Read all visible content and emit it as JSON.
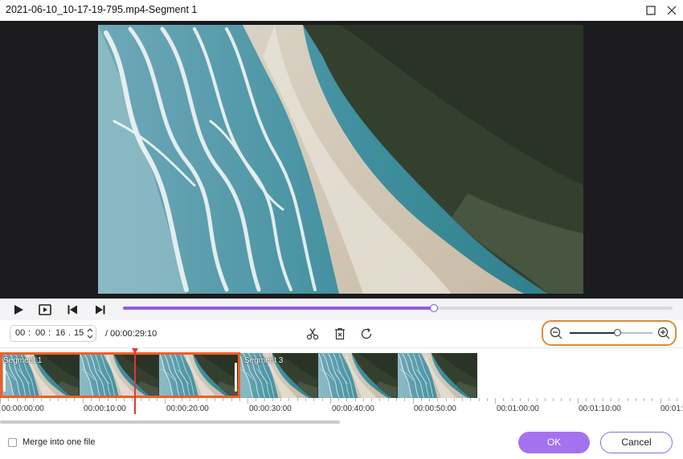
{
  "window": {
    "title": "2021-06-10_10-17-19-795.mp4-Segment 1",
    "maximize_icon": "maximize-icon",
    "close_icon": "close-icon"
  },
  "player": {
    "controls": {
      "play_icon": "play-icon",
      "stop_icon": "stop-icon",
      "prev_icon": "skip-previous-icon",
      "next_icon": "skip-next-icon"
    },
    "progress_fraction": 0.566
  },
  "toolbar": {
    "current_time": {
      "hh": "00",
      "mm": "00",
      "ss": "16",
      "ff": "15"
    },
    "total_time": "/ 00:00:29:10",
    "tools": [
      "scissors-icon",
      "delete-icon",
      "refresh-icon"
    ],
    "zoom_fraction": 0.57
  },
  "timeline": {
    "segments": [
      {
        "label": "Segment 1",
        "selected": true
      },
      {
        "label": "Segment 3",
        "selected": false
      }
    ],
    "ruler_labels": [
      "00:00:00:00",
      "00:00:10:00",
      "00:00:20:00",
      "00:00:30:00",
      "00:00:40:00",
      "00:00:50:00",
      "00:01:00:00",
      "00:01:10:00",
      "00:01:2"
    ]
  },
  "footer": {
    "merge_label": "Merge into one file",
    "merge_checked": false,
    "ok_label": "OK",
    "cancel_label": "Cancel"
  },
  "colors": {
    "accent": "#a472ef",
    "selection": "#ee5f27",
    "zoom_highlight": "#e0893a",
    "playhead": "#e0363a"
  }
}
